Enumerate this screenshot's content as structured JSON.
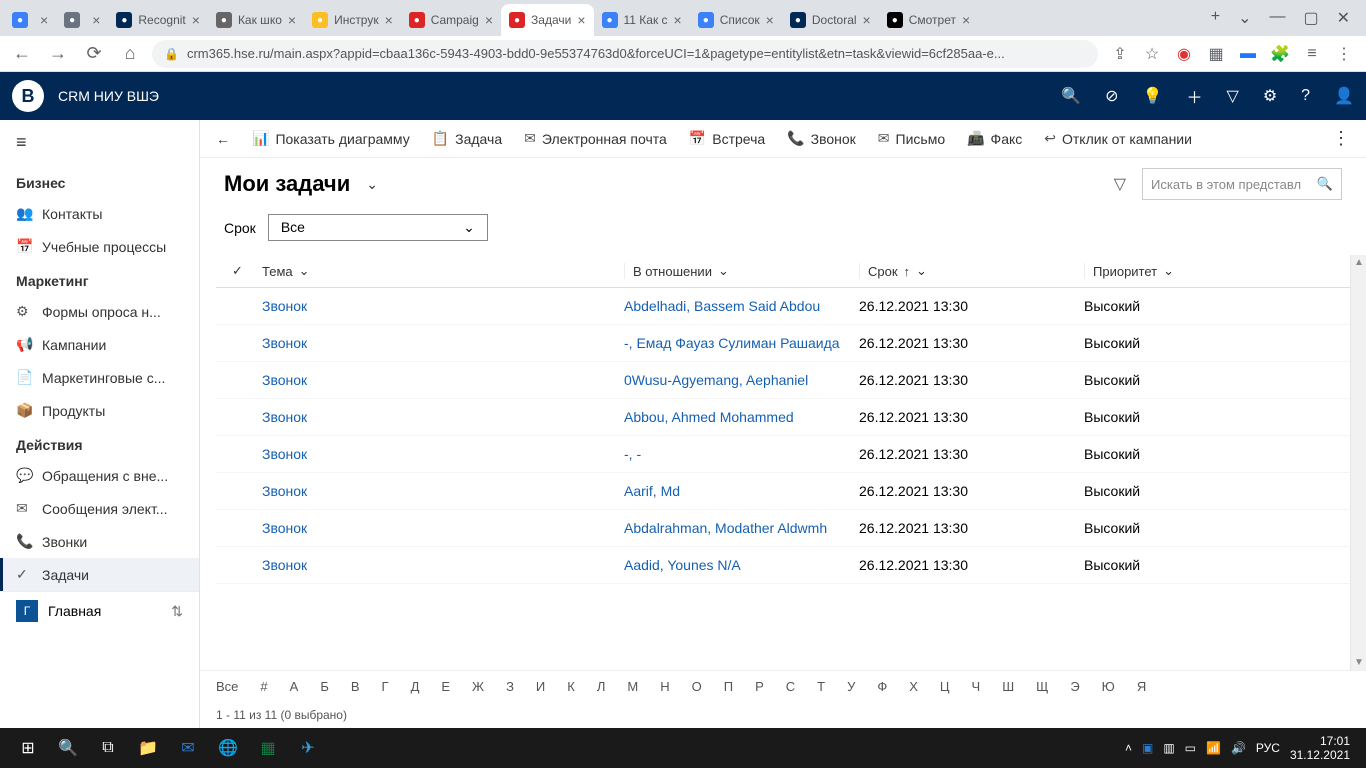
{
  "browser": {
    "tabs": [
      {
        "title": "",
        "color": "#3b82f6"
      },
      {
        "title": "",
        "color": "#6b7280"
      },
      {
        "title": "Recognit",
        "color": "#022955"
      },
      {
        "title": "Как шко",
        "color": "#666"
      },
      {
        "title": "Инструк",
        "color": "#fbbf24"
      },
      {
        "title": "Campaig",
        "color": "#dc2626"
      },
      {
        "title": "Задачи",
        "color": "#dc2626",
        "active": true
      },
      {
        "title": "11 Как с",
        "color": "#3b82f6"
      },
      {
        "title": "Список",
        "color": "#3b82f6"
      },
      {
        "title": "Doctoral",
        "color": "#022955"
      },
      {
        "title": "Смотрет",
        "color": "#000"
      }
    ],
    "url": "crm365.hse.ru/main.aspx?appid=cbaa136c-5943-4903-bdd0-9e55374763d0&forceUCI=1&pagetype=entitylist&etn=task&viewid=6cf285aa-e..."
  },
  "app": {
    "brand": "CRM НИУ ВШЭ"
  },
  "sidebar": {
    "groups": [
      {
        "title": "Бизнес",
        "items": [
          {
            "icon": "👥",
            "label": "Контакты"
          },
          {
            "icon": "📅",
            "label": "Учебные процессы"
          }
        ]
      },
      {
        "title": "Маркетинг",
        "items": [
          {
            "icon": "⚙",
            "label": "Формы опроса н..."
          },
          {
            "icon": "📢",
            "label": "Кампании"
          },
          {
            "icon": "📄",
            "label": "Маркетинговые с..."
          },
          {
            "icon": "📦",
            "label": "Продукты"
          }
        ]
      },
      {
        "title": "Действия",
        "items": [
          {
            "icon": "💬",
            "label": "Обращения с вне..."
          },
          {
            "icon": "✉",
            "label": "Сообщения элект..."
          },
          {
            "icon": "📞",
            "label": "Звонки"
          },
          {
            "icon": "✓",
            "label": "Задачи",
            "active": true
          }
        ]
      }
    ],
    "footer": {
      "badge": "Г",
      "label": "Главная"
    }
  },
  "commandbar": {
    "items": [
      {
        "icon": "📊",
        "label": "Показать диаграмму"
      },
      {
        "icon": "📋",
        "label": "Задача"
      },
      {
        "icon": "✉",
        "label": "Электронная почта"
      },
      {
        "icon": "📅",
        "label": "Встреча"
      },
      {
        "icon": "📞",
        "label": "Звонок"
      },
      {
        "icon": "✉",
        "label": "Письмо"
      },
      {
        "icon": "📠",
        "label": "Факс"
      },
      {
        "icon": "↩",
        "label": "Отклик от кампании"
      }
    ]
  },
  "view": {
    "title": "Мои задачи",
    "search_placeholder": "Искать в этом представл",
    "filter_label": "Срок",
    "filter_value": "Все"
  },
  "grid": {
    "headers": {
      "tema": "Тема",
      "rel": "В отношении",
      "srok": "Срок",
      "prio": "Приоритет"
    },
    "rows": [
      {
        "tema": "Звонок",
        "rel": "Abdelhadi, Bassem Said Abdou",
        "srok": "26.12.2021 13:30",
        "prio": "Высокий"
      },
      {
        "tema": "Звонок",
        "rel": "-, Емад Фауаз Сулиман Рашаида",
        "srok": "26.12.2021 13:30",
        "prio": "Высокий"
      },
      {
        "tema": "Звонок",
        "rel": "0Wusu-Agyemang, Aephaniel",
        "srok": "26.12.2021 13:30",
        "prio": "Высокий"
      },
      {
        "tema": "Звонок",
        "rel": "Abbou, Ahmed Mohammed",
        "srok": "26.12.2021 13:30",
        "prio": "Высокий"
      },
      {
        "tema": "Звонок",
        "rel": "-, -",
        "srok": "26.12.2021 13:30",
        "prio": "Высокий"
      },
      {
        "tema": "Звонок",
        "rel": "Aarif, Md",
        "srok": "26.12.2021 13:30",
        "prio": "Высокий"
      },
      {
        "tema": "Звонок",
        "rel": "Abdalrahman, Modather Aldwmh",
        "srok": "26.12.2021 13:30",
        "prio": "Высокий"
      },
      {
        "tema": "Звонок",
        "rel": "Aadid, Younes N/A",
        "srok": "26.12.2021 13:30",
        "prio": "Высокий"
      }
    ]
  },
  "alpha": [
    "Все",
    "#",
    "А",
    "Б",
    "В",
    "Г",
    "Д",
    "Е",
    "Ж",
    "З",
    "И",
    "К",
    "Л",
    "М",
    "Н",
    "О",
    "П",
    "Р",
    "С",
    "Т",
    "У",
    "Ф",
    "Х",
    "Ц",
    "Ч",
    "Ш",
    "Щ",
    "Э",
    "Ю",
    "Я"
  ],
  "status": "1 - 11 из 11 (0 выбрано)",
  "taskbar": {
    "lang": "РУС",
    "time": "17:01",
    "date": "31.12.2021"
  }
}
